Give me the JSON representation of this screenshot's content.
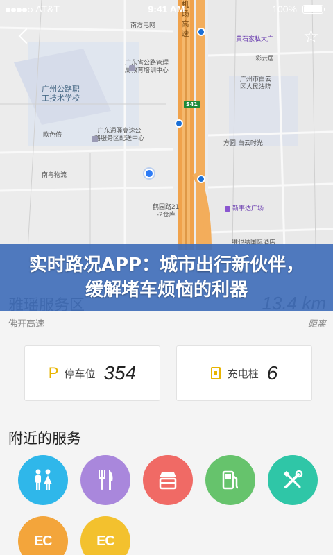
{
  "status_bar": {
    "carrier": "AT&T",
    "time": "9:41 AM",
    "battery": "100%"
  },
  "map": {
    "labels": {
      "nanfang_network": "南方电网",
      "airport_expressway": "机场高速",
      "guangdong_highway_mgmt": "广东省公路管理\n局教育培训中心",
      "huangshijia_plaza": "黄石家私大广",
      "caiyun_residence": "彩云居",
      "guangzhou_highway_school": "广州公路职\n工技术学校",
      "guangzhou_court": "广州市白云\n区人民法院",
      "dasheng": "欧色倍",
      "expressway_service": "广东通驿高速公\n路服务区配送中心",
      "fangyuan_baiyun": "方圆·白云时光",
      "nanyue_logistics": "南粤物流",
      "xinshida_plaza": "新事达广场",
      "yinglu": "鹤园路21\n-2仓库",
      "weilan_hotel": "维也纳国际酒店",
      "route_shield": "S41"
    }
  },
  "banner": {
    "text": "实时路况APP：城市出行新伙伴，缓解堵车烦恼的利器"
  },
  "destination": {
    "name": "雅瑶服务区",
    "road": "佛开高速",
    "distance": "13.4 km",
    "distance_label": "距离"
  },
  "cards": {
    "parking": {
      "icon": "P",
      "label": "停车位",
      "value": "354"
    },
    "charging": {
      "label": "充电桩",
      "value": "6"
    }
  },
  "nearby": {
    "title": "附近的服务",
    "ec_label": "EC"
  }
}
